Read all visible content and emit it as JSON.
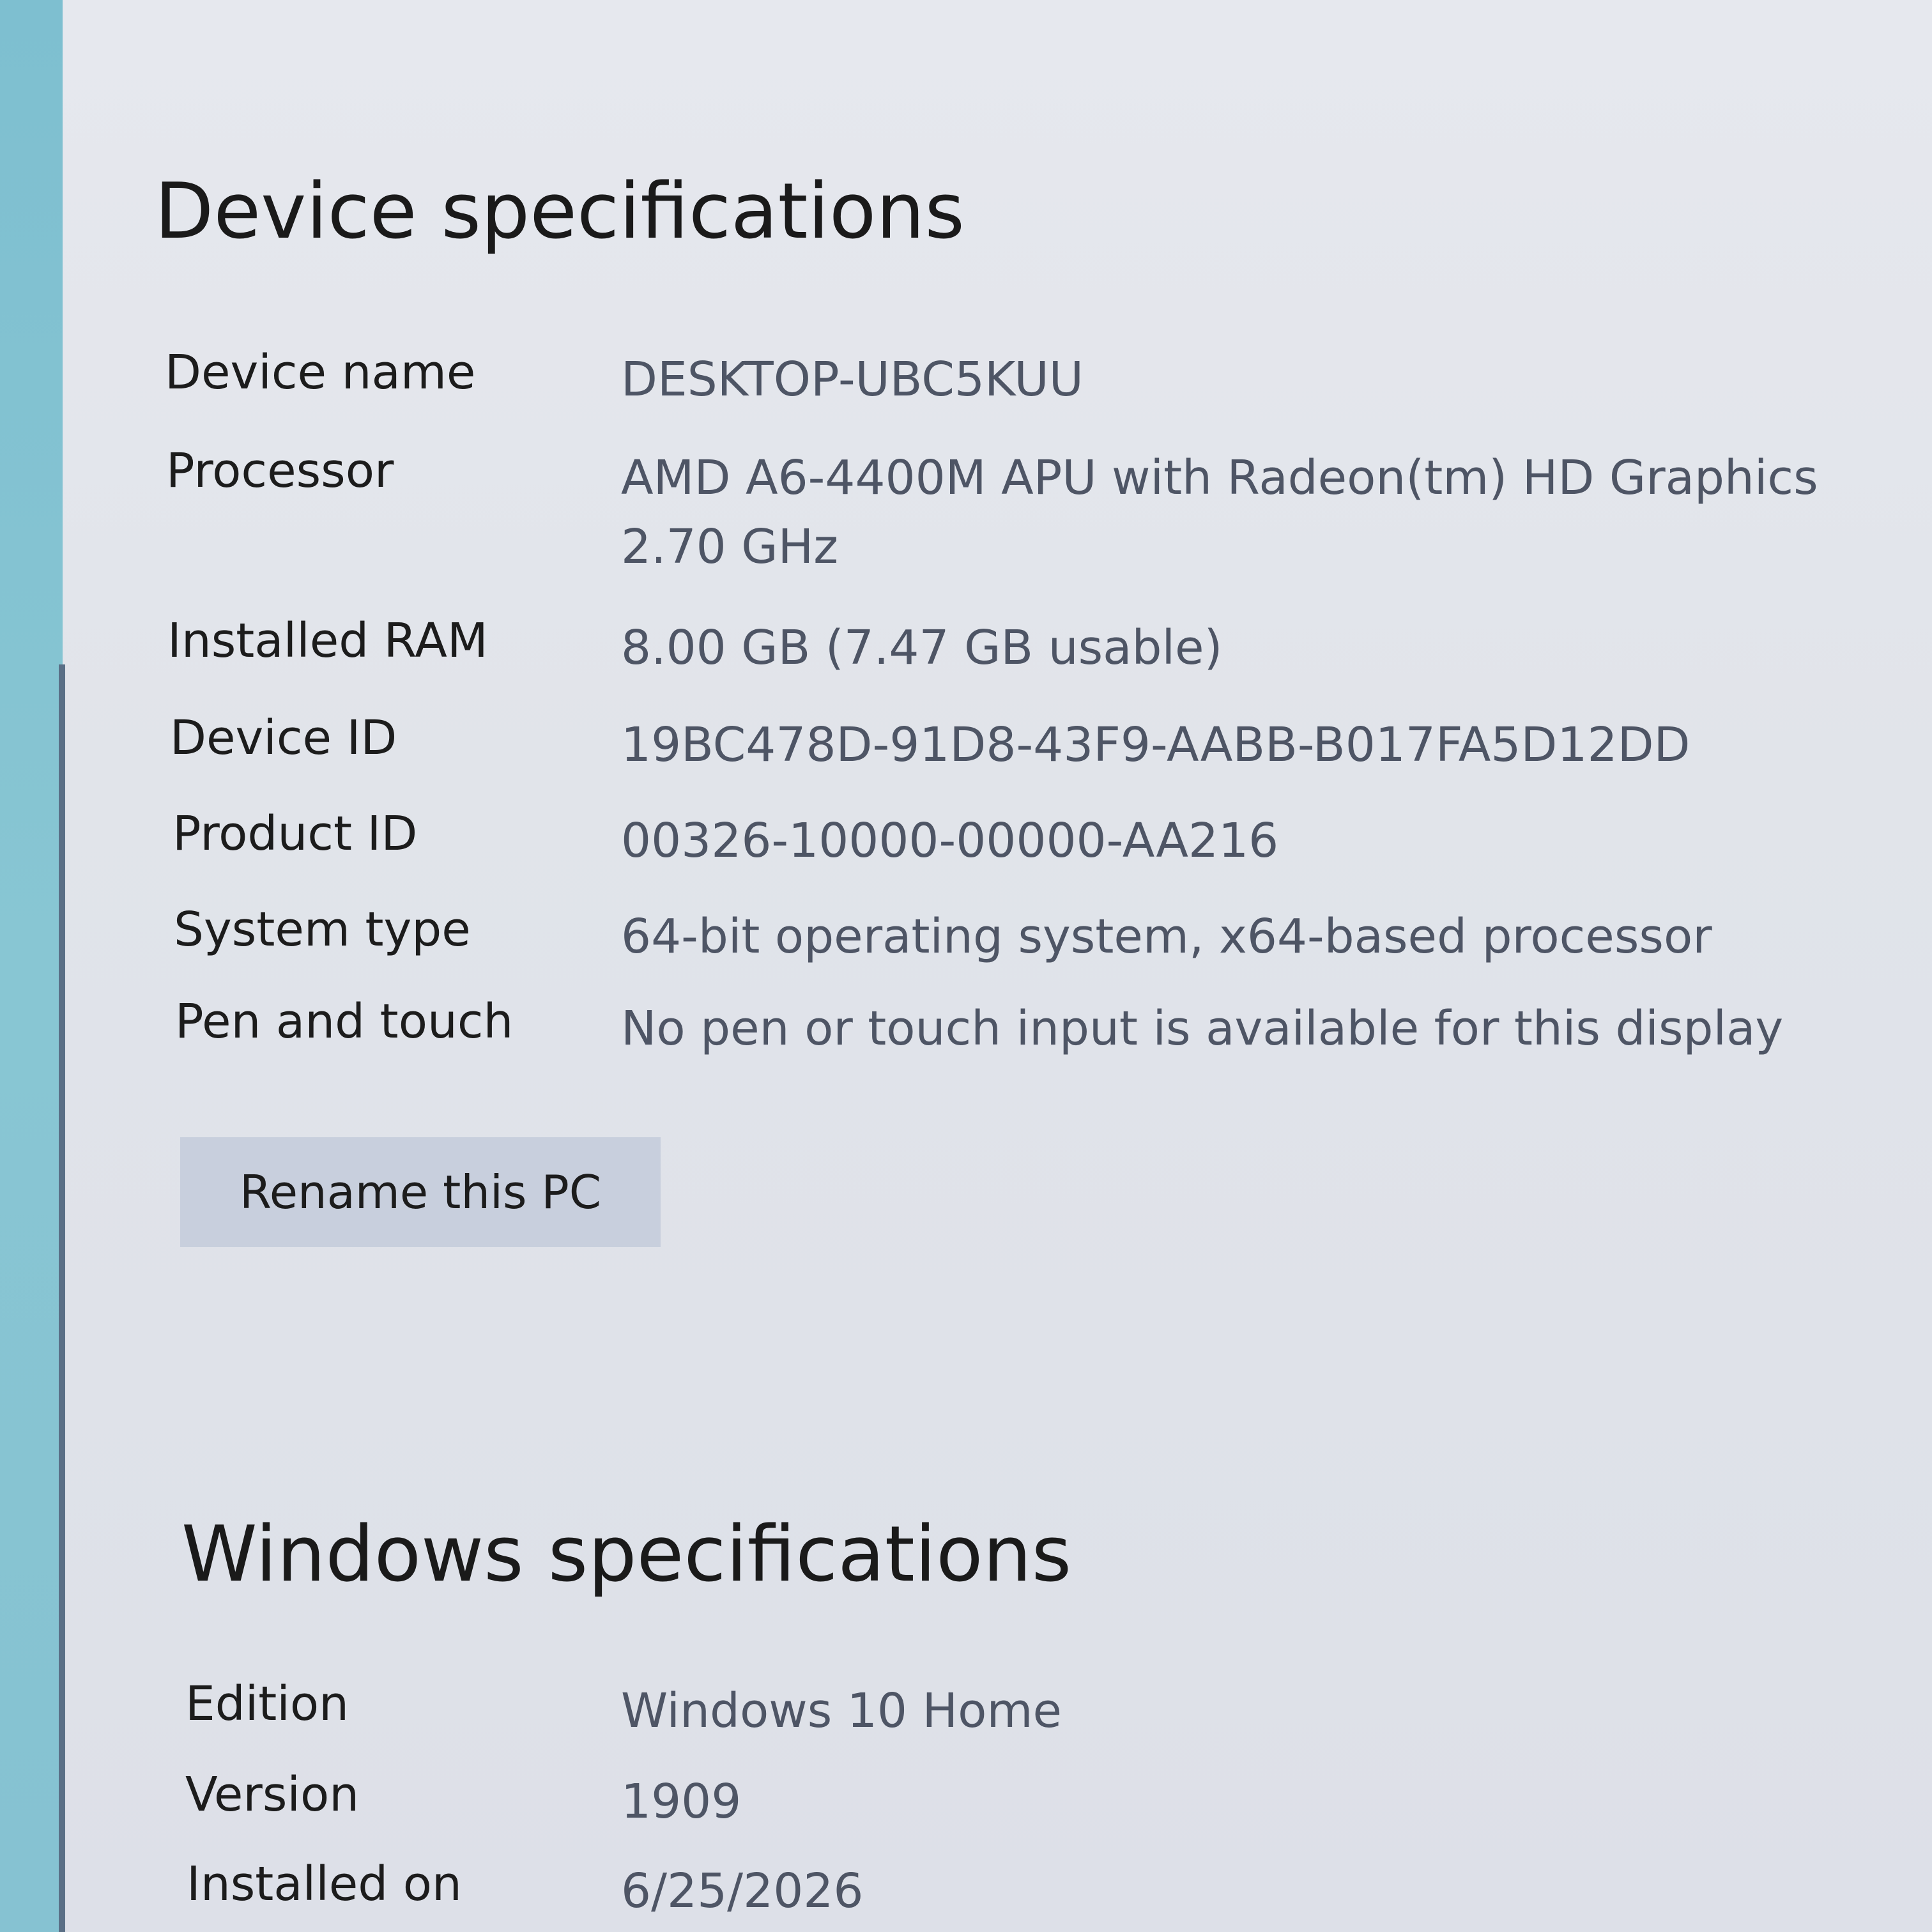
{
  "device_specs": {
    "title": "Device specifications",
    "rows": [
      {
        "label": "Device name",
        "value": "DESKTOP-UBC5KUU"
      },
      {
        "label": "Processor",
        "value": "AMD A6-4400M APU with Radeon(tm) HD Graphics 2.70 GHz"
      },
      {
        "label": "Installed RAM",
        "value": "8.00 GB (7.47 GB usable)"
      },
      {
        "label": "Device ID",
        "value": "19BC478D-91D8-43F9-AABB-B017FA5D12DD"
      },
      {
        "label": "Product ID",
        "value": "00326-10000-00000-AA216"
      },
      {
        "label": "System type",
        "value": "64-bit operating system, x64-based processor"
      },
      {
        "label": "Pen and touch",
        "value": "No pen or touch input is available for this display"
      }
    ],
    "rename_button": "Rename this PC"
  },
  "windows_specs": {
    "title": "Windows specifications",
    "rows": [
      {
        "label": "Edition",
        "value": "Windows 10 Home"
      },
      {
        "label": "Version",
        "value": "1909"
      },
      {
        "label": "Installed on",
        "value": "6/25/2026"
      }
    ]
  }
}
